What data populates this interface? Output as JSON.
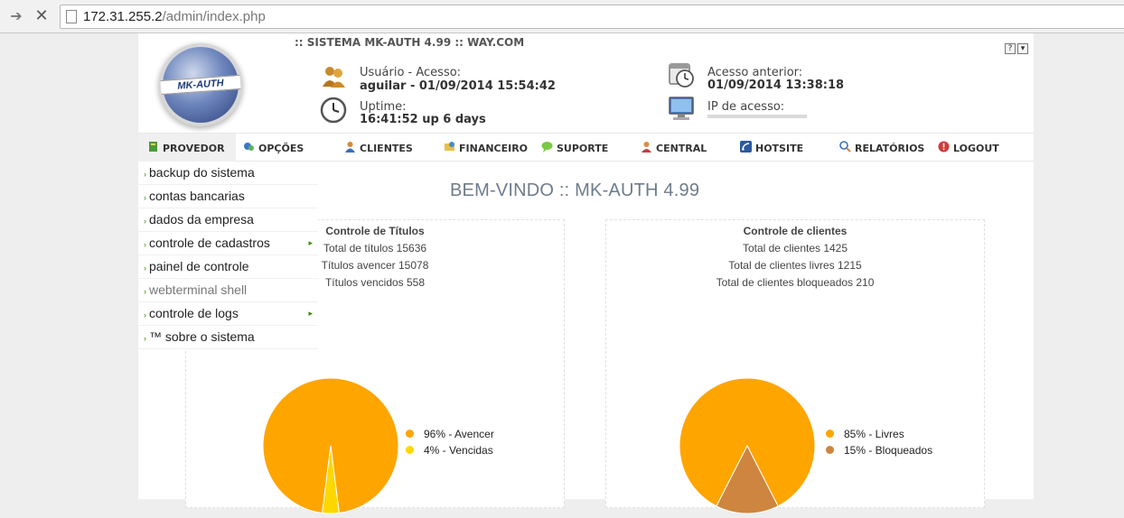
{
  "browser": {
    "url_host": "172.31.255.2",
    "url_path": "/admin/index.php"
  },
  "header": {
    "system_title": ":: SISTEMA MK-AUTH 4.99 :: WAY.COM",
    "logo_text": "MK-AUTH",
    "help_icon_label": "?",
    "menu_icon_label": "▾",
    "user_label": "Usuário - Acesso:",
    "user_value": "aguilar - 01/09/2014 15:54:42",
    "uptime_label": "Uptime:",
    "uptime_value": "16:41:52 up 6 days",
    "last_access_label": "Acesso anterior:",
    "last_access_value": "01/09/2014 13:38:18",
    "ip_label": "IP de acesso:"
  },
  "menu": {
    "items": [
      {
        "label": "PROVEDOR",
        "icon": "provedor-icon"
      },
      {
        "label": "OPÇÕES",
        "icon": "opcoes-icon"
      },
      {
        "label": "CLIENTES",
        "icon": "clientes-icon"
      },
      {
        "label": "FINANCEIRO",
        "icon": "financeiro-icon"
      },
      {
        "label": "SUPORTE",
        "icon": "suporte-icon"
      },
      {
        "label": "CENTRAL",
        "icon": "central-icon"
      },
      {
        "label": "HOTSITE",
        "icon": "hotsite-icon"
      },
      {
        "label": "RELATÓRIOS",
        "icon": "relatorios-icon"
      },
      {
        "label": "LOGOUT",
        "icon": "logout-icon"
      }
    ]
  },
  "dropdown": {
    "items": [
      {
        "label": "backup do sistema",
        "submenu": false
      },
      {
        "label": "contas bancarias",
        "submenu": false
      },
      {
        "label": "dados da empresa",
        "submenu": false
      },
      {
        "label": "controle de cadastros",
        "submenu": true
      },
      {
        "label": "painel de controle",
        "submenu": false
      },
      {
        "label": "webterminal shell",
        "submenu": false
      },
      {
        "label": "controle de logs",
        "submenu": true
      },
      {
        "label": "™ sobre o sistema",
        "submenu": false
      }
    ]
  },
  "main": {
    "welcome": "BEM-VINDO :: MK-AUTH 4.99"
  },
  "titulos": {
    "title": "Controle de Títulos",
    "line1": "Total de títulos 15636",
    "line2": "Títulos avencer 15078",
    "line3": "Títulos vencidos 558"
  },
  "clientes": {
    "title": "Controle de clientes",
    "line1": "Total de clientes 1425",
    "line2": "Total de clientes livres 1215",
    "line3": "Total de clientes bloqueados 210"
  },
  "chart_data": [
    {
      "type": "pie",
      "title": "",
      "series": [
        {
          "name": "96% - Avencer",
          "value": 96,
          "color": "#ffa500"
        },
        {
          "name": "4% - Vencidas",
          "value": 4,
          "color": "#ffd700"
        }
      ]
    },
    {
      "type": "pie",
      "title": "",
      "series": [
        {
          "name": "85% - Livres",
          "value": 85,
          "color": "#ffa500"
        },
        {
          "name": "15% - Bloqueados",
          "value": 15,
          "color": "#cd853f"
        }
      ]
    }
  ]
}
